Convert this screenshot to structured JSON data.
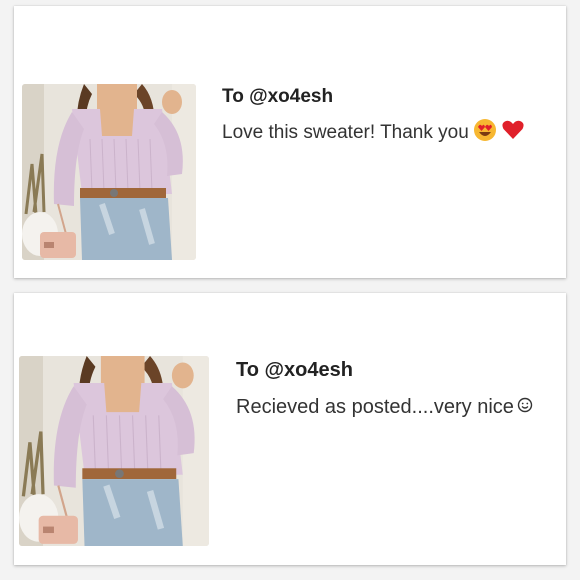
{
  "reviews": [
    {
      "to_label": "To @xo4esh",
      "message": "Love this sweater! Thank you",
      "emojis": [
        "heart-eyes-emoji",
        "red-heart-emoji"
      ]
    },
    {
      "to_label": "To @xo4esh",
      "message": "Recieved as posted....very nice",
      "emojis": [
        "smiley-emoji"
      ]
    }
  ],
  "colors": {
    "sweater": "#dcc6dc",
    "belt": "#a0673a",
    "jeans": "#9fb6c9",
    "emoji_yellow": "#f7b731",
    "heart_red": "#e0202a"
  }
}
